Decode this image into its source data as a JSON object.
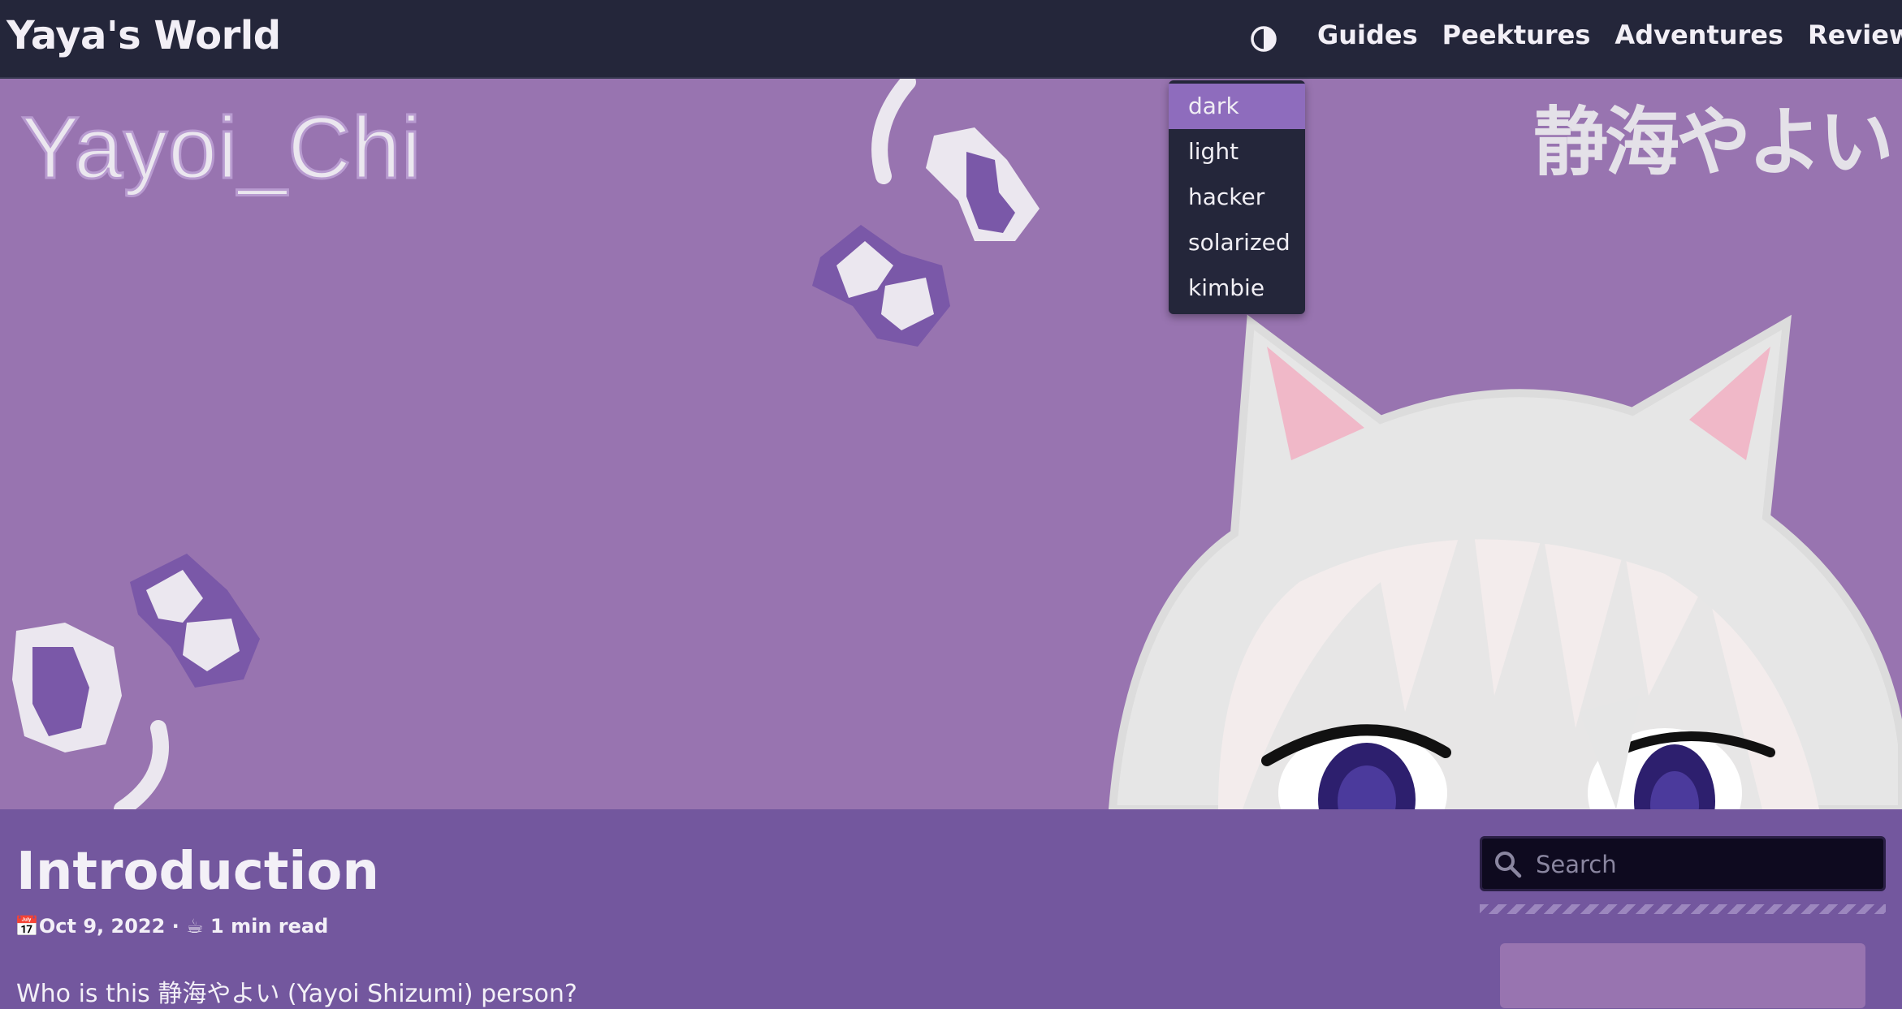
{
  "header": {
    "site_title": "Yaya's World",
    "theme_toggle_icon": "contrast-icon",
    "nav": [
      "Guides",
      "Peektures",
      "Adventures",
      "Reviews"
    ]
  },
  "theme_menu": {
    "options": [
      "dark",
      "light",
      "hacker",
      "solarized",
      "kimbie"
    ],
    "selected": "dark"
  },
  "hero": {
    "name_text": "Yayoi_Chi",
    "jp_text": "静海やよい"
  },
  "post": {
    "title": "Introduction",
    "date_icon": "📅",
    "date": "Oct 9, 2022",
    "separator": " · ",
    "read_icon": "☕",
    "read_time": "1 min read",
    "intro": "Who is this 静海やよい (Yayoi Shizumi) person?"
  },
  "sidebar": {
    "search_placeholder": "Search"
  },
  "colors": {
    "topbar": "#24263a",
    "hero_bg": "#9874b0",
    "content_bg": "#73579e",
    "accent": "#8e6cbd"
  }
}
